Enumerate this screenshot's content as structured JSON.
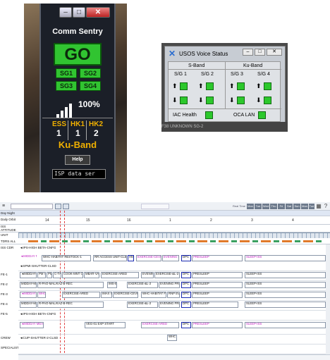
{
  "comm_sentry": {
    "title": "Comm Sentry",
    "go_label": "GO",
    "sg_buttons": [
      "SG1",
      "SG2",
      "SG3",
      "SG4"
    ],
    "signal_percent": "100%",
    "links": [
      {
        "name": "ESS",
        "value": "1"
      },
      {
        "name": "HK1",
        "value": "1"
      },
      {
        "name": "HK2",
        "value": "2"
      }
    ],
    "band": "Ku-Band",
    "help_label": "Help",
    "ticker": "ISP data ser",
    "colors": {
      "go": "#31c431",
      "band_text": "#f0b000"
    }
  },
  "voice_status": {
    "title": "USOS Voice Status",
    "bands": [
      "S-Band",
      "Ku-Band"
    ],
    "sg_labels": [
      "S/G 1",
      "S/G 2",
      "S/G 3",
      "S/G 4"
    ],
    "iac_label": "IAC Health",
    "oca_label": "OCA LAN",
    "footer": "F38   UNKNOWN          SG-2",
    "colors": {
      "indicator": "#2cc82c"
    }
  },
  "timeline": {
    "row_headers": [
      "Day Night",
      "Daily Orbit",
      "ISS ATTITUDE",
      "UNIT",
      "TDRS ALL"
    ],
    "days": [
      "14",
      "15",
      "16",
      "1",
      "2",
      "3",
      "4"
    ],
    "crew_rows": [
      {
        "label": "ISS CDR",
        "note": "◄IPS-HIGH BETA-CNFG",
        "note2": "◄SPMI-SHUTTER-CLSD"
      },
      {
        "label": "FE-1"
      },
      {
        "label": "FE-2"
      },
      {
        "label": "FE-3"
      },
      {
        "label": "FE-4"
      },
      {
        "label": "FE-5",
        "note": "◄IPS-HIGH BETA-CNFG"
      },
      {
        "label": "CREW",
        "note": "◄CUP-SHUTTER-2-CLSD"
      },
      {
        "label": "SPECIALIST"
      }
    ],
    "events": {
      "r1": [
        "◄MIDDAY MEAL",
        "WHC-HABITAT RESTOCK-1",
        "RR ACCESS UNIT-CLEAN",
        "HMS",
        "EXERCISE-CEVIS",
        "EVENING PREP",
        "DPC",
        "PRESLEEP",
        "SLEEP-ISS"
      ],
      "r2": [
        "◄MIDDAY-PA MEAL",
        "PM VIDEO",
        "PM CS",
        "C-TA CLEAN",
        "COOK-MNT CLSD",
        "MBAR-VAL",
        "EXERCISE-ARED",
        "EVENING PREP",
        "EXERCISE-&L-2",
        "DPC",
        "PRESLEEP",
        "SLEEP-ISS"
      ],
      "r3": [
        "MIDDAY-MEAL",
        "R-PAO-MAL/KAZ-B-REC",
        "IMS-EDIT",
        "EXERCISE-&L-2",
        "EVENING PREP-WORK",
        "DPC",
        "PRESLEEP",
        "SLEEP-ISS"
      ],
      "r4": [
        "◄MIDDAY MEAL",
        "WHC",
        "EXERCISE-ARED",
        "IMAX INTER",
        "EXERCISE-CEVIS",
        "WHC-HABITAT FLTO-FILL",
        "RNP EVOC",
        "DPC",
        "PRESLEEP",
        "SLEEP-ISS"
      ],
      "r5": [
        "MIDDAY-MEAL",
        "R-PAO-MAL/KAZ-B-REC",
        "EXERCISE-&L-2",
        "EVENING PREP-WORK",
        "DPC",
        "PRESLEEP",
        "SLEEP-ISS"
      ],
      "r6": [
        "◄MIDDAY MEAL",
        "VEG-01 EXP START",
        "EXERCISE-ARED",
        "DPC",
        "PRESLEEP",
        "SLEEP-ISS"
      ],
      "crew": [
        "WHC UNKN"
      ]
    },
    "top_buttons": [
      "Real Time",
      "Mon",
      "Tue",
      "Wed",
      "Thu",
      "Fri",
      "Sat",
      "Sun",
      "Mon",
      "Tue"
    ]
  }
}
